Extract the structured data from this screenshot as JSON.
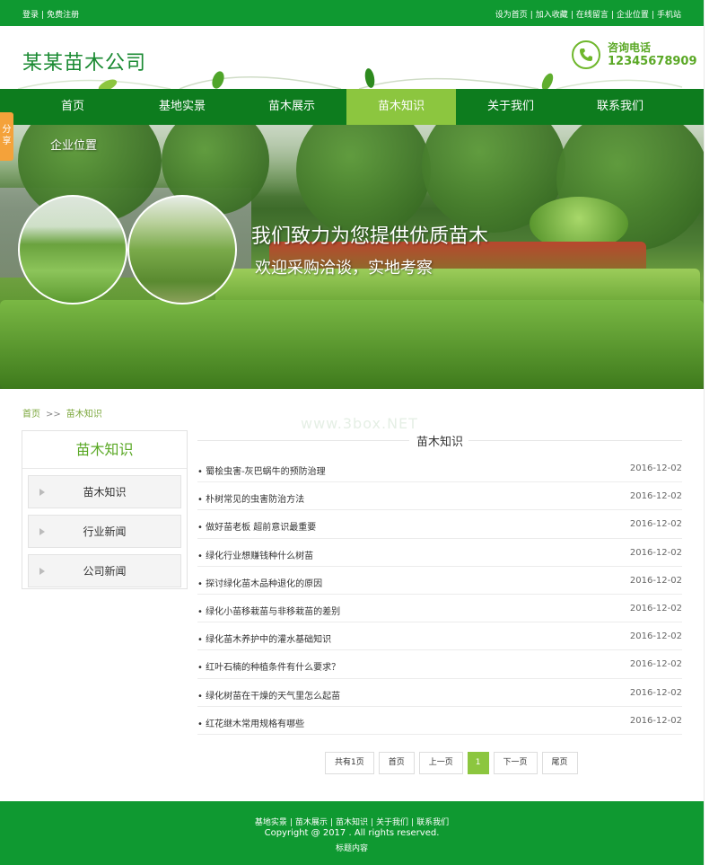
{
  "topbar": {
    "left_links": [
      "登录",
      "免费注册"
    ],
    "right_links": [
      "设为首页",
      "加入收藏",
      "在线留言",
      "企业位置",
      "手机站"
    ]
  },
  "header": {
    "logo": "某某苗木公司",
    "phone_label": "咨询电话",
    "phone_number": "12345678909",
    "phone_icon": "phone-icon"
  },
  "nav": {
    "items": [
      "首页",
      "基地实景",
      "苗木展示",
      "苗木知识",
      "关于我们",
      "联系我们"
    ],
    "active": "苗木知识"
  },
  "banner": {
    "location_label": "企业位置",
    "title": "我们致力为您提供优质苗木",
    "subtitle": "欢迎采购洽谈，实地考察",
    "share_label": "分享"
  },
  "breadcrumb": {
    "home": "首页",
    "separator": ">>",
    "current": "苗木知识"
  },
  "sidebar": {
    "title": "苗木知识",
    "items": [
      "苗木知识",
      "行业新闻",
      "公司新闻"
    ]
  },
  "main": {
    "title": "苗木知识",
    "watermark": "www.3box.NET",
    "articles": [
      {
        "title": "• 蜀桧虫害-灰巴蜗牛的预防治理",
        "date": "2016-12-02"
      },
      {
        "title": "• 朴树常见的虫害防治方法",
        "date": "2016-12-02"
      },
      {
        "title": "• 做好苗老板 超前意识最重要",
        "date": "2016-12-02"
      },
      {
        "title": "• 绿化行业想赚钱种什么树苗",
        "date": "2016-12-02"
      },
      {
        "title": "• 探讨绿化苗木品种退化的原因",
        "date": "2016-12-02"
      },
      {
        "title": "• 绿化小苗移栽苗与非移栽苗的差别",
        "date": "2016-12-02"
      },
      {
        "title": "• 绿化苗木养护中的灌水基础知识",
        "date": "2016-12-02"
      },
      {
        "title": "• 红叶石楠的种植条件有什么要求？",
        "date": "2016-12-02"
      },
      {
        "title": "• 绿化树苗在干燥的天气里怎么起苗",
        "date": "2016-12-02"
      },
      {
        "title": "• 红花继木常用规格有哪些",
        "date": "2016-12-02"
      }
    ]
  },
  "pagination": {
    "total": "共有1页",
    "first": "首页",
    "prev": "上一页",
    "current": "1",
    "next": "下一页",
    "last": "尾页"
  },
  "footer": {
    "links": [
      "基地实景",
      "苗木展示",
      "苗木知识",
      "关于我们",
      "联系我们"
    ],
    "copyright": "Copyright @ 2017 . All rights reserved.",
    "sub": "标题内容"
  },
  "colors": {
    "brand_green": "#0f9931",
    "nav_green": "#0d7c1e",
    "accent_light_green": "#8cc63f"
  }
}
